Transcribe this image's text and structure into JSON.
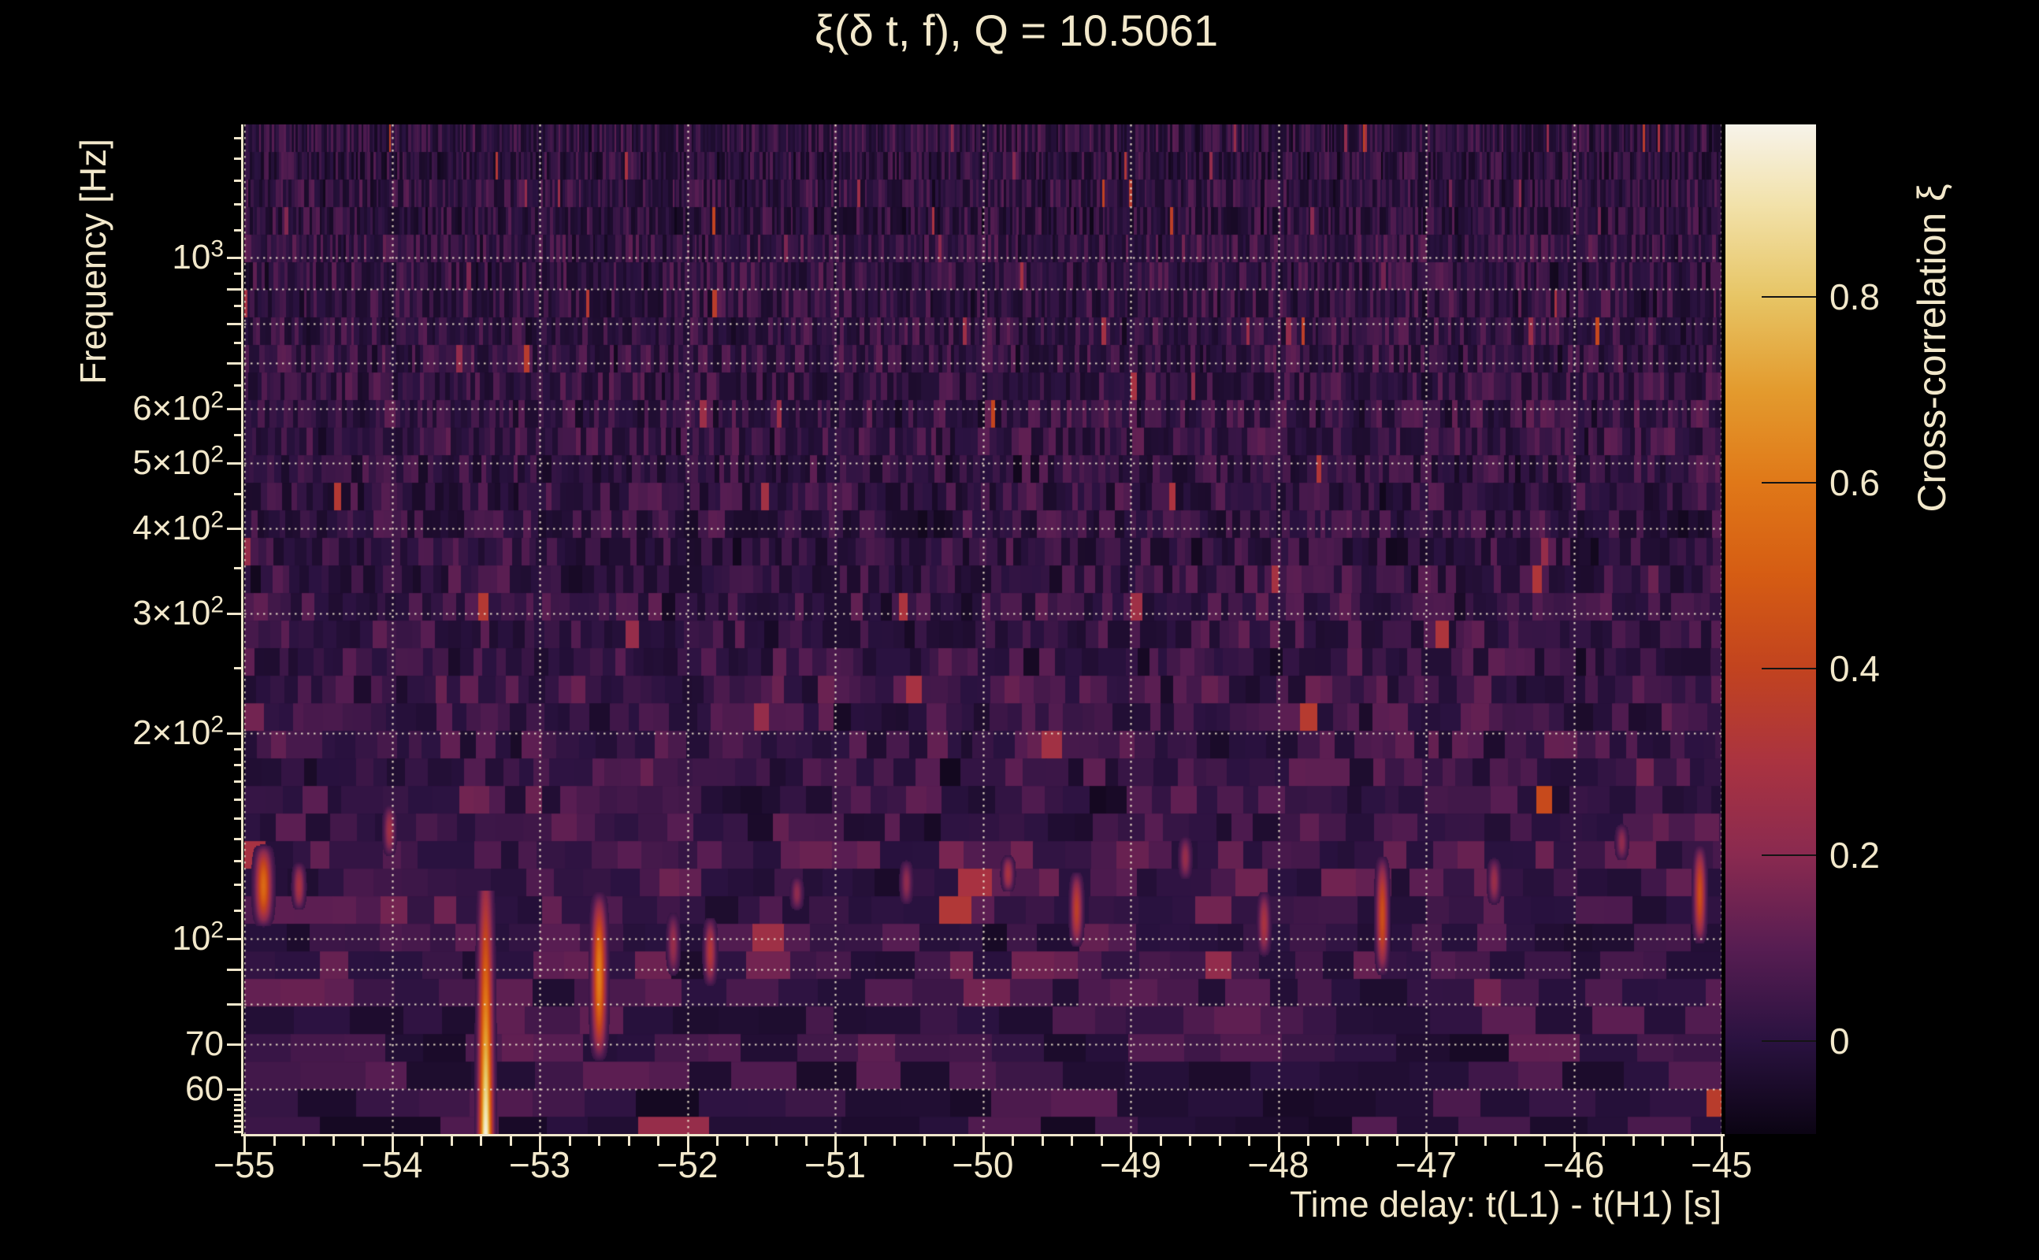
{
  "title": "ξ(δ t, f), Q = 10.5061",
  "x_axis": {
    "label": "Time delay: t(L1) - t(H1) [s]",
    "range_s": [
      -55,
      -45
    ],
    "major_ticks": [
      -55,
      -54,
      -53,
      -52,
      -51,
      -50,
      -49,
      -48,
      -47,
      -46,
      -45
    ],
    "tick_labels": [
      "−55",
      "−54",
      "−53",
      "−52",
      "−51",
      "−50",
      "−49",
      "−48",
      "−47",
      "−46",
      "−45"
    ],
    "minor_tick_step_s": 0.2
  },
  "y_axis": {
    "label": "Frequency [Hz]",
    "scale": "log",
    "range_hz": [
      51.6,
      1570
    ],
    "labeled_ticks": [
      {
        "coef": "10",
        "sup": "3",
        "hz": 1000
      },
      {
        "coef": "6×10",
        "sup": "2",
        "hz": 600
      },
      {
        "coef": "5×10",
        "sup": "2",
        "hz": 500
      },
      {
        "coef": "4×10",
        "sup": "2",
        "hz": 400
      },
      {
        "coef": "3×10",
        "sup": "2",
        "hz": 300
      },
      {
        "coef": "2×10",
        "sup": "2",
        "hz": 200
      },
      {
        "coef": "10",
        "sup": "2",
        "hz": 100
      },
      {
        "coef": "70",
        "sup": "",
        "hz": 70
      },
      {
        "coef": "60",
        "sup": "",
        "hz": 60
      }
    ],
    "minor_ticks_hz": [
      52,
      53,
      54,
      55,
      56,
      57,
      58,
      59,
      110,
      120,
      130,
      140,
      150,
      160,
      170,
      180,
      190,
      250,
      350,
      450,
      550,
      650,
      750,
      850,
      950,
      1100,
      1200,
      1300,
      1400,
      1500
    ]
  },
  "colorbar": {
    "label": "Cross-correlation ξ",
    "min": -0.1,
    "max": 0.985,
    "ticks": [
      {
        "value": 0.8,
        "label": "0.8"
      },
      {
        "value": 0.6,
        "label": "0.6"
      },
      {
        "value": 0.4,
        "label": "0.4"
      },
      {
        "value": 0.2,
        "label": "0.2"
      },
      {
        "value": 0.0,
        "label": "0"
      }
    ]
  },
  "chart_data": {
    "type": "heatmap",
    "subtype": "constant-Q cross-correlation spectrogram",
    "title": "ξ(δ t, f), Q = 10.5061",
    "xlabel": "Time delay: t(L1) - t(H1) [s]",
    "ylabel": "Frequency [Hz]",
    "q_value": 10.5061,
    "x_range_s": [
      -55,
      -45
    ],
    "y_range_hz": [
      51.6,
      1570
    ],
    "value_range": [
      -0.1,
      0.985
    ],
    "grid": {
      "style": "dotted",
      "color": "#efe5cd",
      "vertical_s": [
        -55,
        -54,
        -53,
        -52,
        -51,
        -50,
        -49,
        -48,
        -47,
        -46,
        -45
      ],
      "horizontal_hz": [
        60,
        70,
        80,
        90,
        100,
        200,
        300,
        400,
        500,
        600,
        700,
        800,
        900,
        1000
      ]
    },
    "colormap_stops": [
      {
        "v": -0.1,
        "c": "#0b0413"
      },
      {
        "v": 0.0,
        "c": "#2a1240"
      },
      {
        "v": 0.1,
        "c": "#571d52"
      },
      {
        "v": 0.2,
        "c": "#8a2a50"
      },
      {
        "v": 0.3,
        "c": "#aa3340"
      },
      {
        "v": 0.4,
        "c": "#c2431f"
      },
      {
        "v": 0.5,
        "c": "#d55c13"
      },
      {
        "v": 0.6,
        "c": "#e07818"
      },
      {
        "v": 0.7,
        "c": "#e39b2e"
      },
      {
        "v": 0.8,
        "c": "#e7c565"
      },
      {
        "v": 0.9,
        "c": "#f2e2ab"
      },
      {
        "v": 0.985,
        "c": "#f7f3ea"
      }
    ],
    "background_noise": {
      "seed": 1337,
      "base_value": -0.04,
      "noise_amplitude": 0.16,
      "row_decades": 0.0405,
      "tile_s_hz": 22,
      "active_band_hz": [
        78,
        235
      ],
      "active_band_boost": 0.05,
      "speckle_probability": 0.012,
      "speckle_boost_max": 0.28
    },
    "features": [
      {
        "t_s": -53.37,
        "f_lo_hz": 51.6,
        "f_hi_hz": 118,
        "peak_value": 0.97,
        "width_s": 0.06,
        "profile": "bottom-bright"
      },
      {
        "t_s": -54.87,
        "f_lo_hz": 104,
        "f_hi_hz": 138,
        "peak_value": 0.55,
        "width_s": 0.07,
        "profile": "bump"
      },
      {
        "t_s": -54.63,
        "f_lo_hz": 110,
        "f_hi_hz": 130,
        "peak_value": 0.3,
        "width_s": 0.05,
        "profile": "bump"
      },
      {
        "t_s": -54.02,
        "f_lo_hz": 132,
        "f_hi_hz": 158,
        "peak_value": 0.27,
        "width_s": 0.05,
        "profile": "bump"
      },
      {
        "t_s": -52.6,
        "f_lo_hz": 66,
        "f_hi_hz": 118,
        "peak_value": 0.62,
        "width_s": 0.06,
        "profile": "bump"
      },
      {
        "t_s": -52.1,
        "f_lo_hz": 88,
        "f_hi_hz": 110,
        "peak_value": 0.24,
        "width_s": 0.05,
        "profile": "bump"
      },
      {
        "t_s": -51.85,
        "f_lo_hz": 85,
        "f_hi_hz": 108,
        "peak_value": 0.33,
        "width_s": 0.05,
        "profile": "bump"
      },
      {
        "t_s": -51.26,
        "f_lo_hz": 110,
        "f_hi_hz": 124,
        "peak_value": 0.22,
        "width_s": 0.05,
        "profile": "bump"
      },
      {
        "t_s": -50.52,
        "f_lo_hz": 112,
        "f_hi_hz": 131,
        "peak_value": 0.22,
        "width_s": 0.05,
        "profile": "bump"
      },
      {
        "t_s": -49.83,
        "f_lo_hz": 117,
        "f_hi_hz": 133,
        "peak_value": 0.3,
        "width_s": 0.05,
        "profile": "bump"
      },
      {
        "t_s": -49.37,
        "f_lo_hz": 97,
        "f_hi_hz": 126,
        "peak_value": 0.38,
        "width_s": 0.05,
        "profile": "bump"
      },
      {
        "t_s": -48.63,
        "f_lo_hz": 122,
        "f_hi_hz": 142,
        "peak_value": 0.24,
        "width_s": 0.05,
        "profile": "bump"
      },
      {
        "t_s": -48.1,
        "f_lo_hz": 94,
        "f_hi_hz": 118,
        "peak_value": 0.3,
        "width_s": 0.05,
        "profile": "bump"
      },
      {
        "t_s": -47.3,
        "f_lo_hz": 88,
        "f_hi_hz": 133,
        "peak_value": 0.45,
        "width_s": 0.05,
        "profile": "bump"
      },
      {
        "t_s": -46.54,
        "f_lo_hz": 112,
        "f_hi_hz": 132,
        "peak_value": 0.25,
        "width_s": 0.05,
        "profile": "bump"
      },
      {
        "t_s": -45.68,
        "f_lo_hz": 130,
        "f_hi_hz": 148,
        "peak_value": 0.22,
        "width_s": 0.05,
        "profile": "bump"
      },
      {
        "t_s": -45.15,
        "f_lo_hz": 98,
        "f_hi_hz": 138,
        "peak_value": 0.45,
        "width_s": 0.05,
        "profile": "bump"
      }
    ]
  }
}
